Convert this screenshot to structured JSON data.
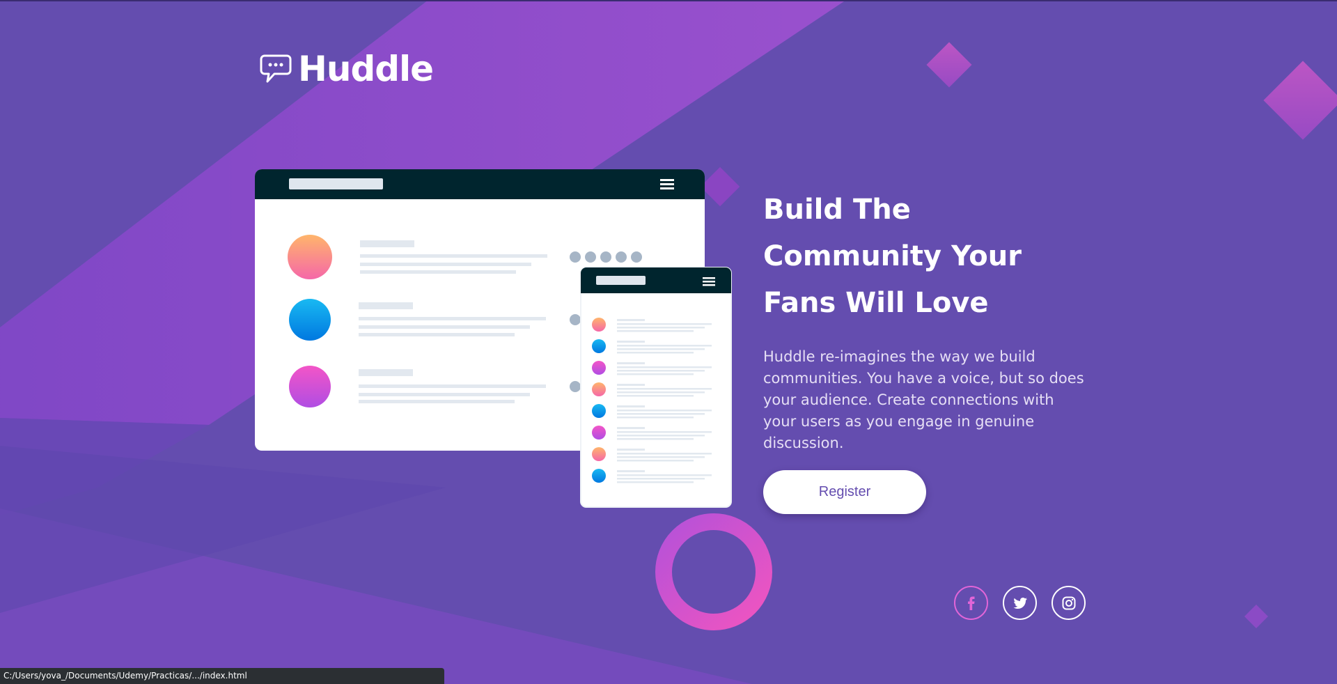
{
  "brand": {
    "name": "Huddle",
    "logo_icon": "chat-bubble-icon"
  },
  "hero": {
    "title_lines": [
      "Build The",
      "Community Your",
      "Fans Will Love"
    ],
    "description": "Huddle re-imagines the way we build communities. You have a voice, but so does your audience. Create connections with your users as you engage in genuine discussion.",
    "register_label": "Register"
  },
  "social": [
    {
      "name": "facebook",
      "icon": "facebook-icon",
      "color": "#e265d8"
    },
    {
      "name": "twitter",
      "icon": "twitter-icon",
      "color": "#ffffff"
    },
    {
      "name": "instagram",
      "icon": "instagram-icon",
      "color": "#ffffff"
    }
  ],
  "status_bar": {
    "url": "C:/Users/yova_/Documents/Udemy/Practicas/.../index.html"
  },
  "colors": {
    "background": "#644daf",
    "background_band": "#8d4fcc",
    "accent_pink": "#e265d8",
    "mockup_header": "#00252e",
    "button_text": "#644daf"
  },
  "mockup": {
    "desktop_avatars": [
      "orange-gradient",
      "blue-gradient",
      "pink-gradient"
    ],
    "mobile_avatars": [
      "orange-gradient",
      "blue-gradient",
      "pink-gradient",
      "orange-gradient",
      "blue-gradient",
      "pink-gradient",
      "orange-gradient",
      "blue-gradient"
    ]
  }
}
